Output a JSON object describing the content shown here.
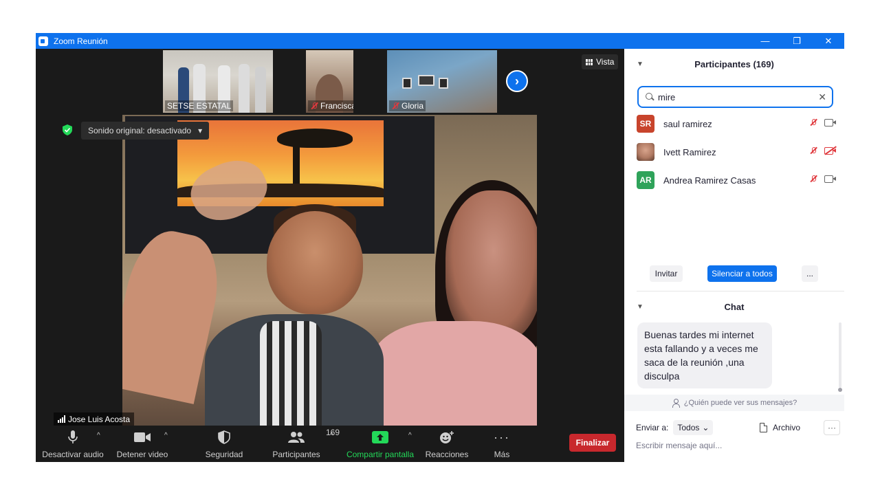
{
  "window": {
    "title": "Zoom Reunión",
    "controls": {
      "minimize": "—",
      "restore": "❐",
      "close": "✕"
    }
  },
  "thumbnails": [
    {
      "name": "SETSE ESTATAL",
      "muted": false
    },
    {
      "name": "Francisca",
      "muted": true
    },
    {
      "name": "Gloria",
      "muted": true
    }
  ],
  "view_button": {
    "label": "Vista"
  },
  "main_video": {
    "sound_label": "Sonido original: desactivado",
    "speaker_name": "Jose Luis Acosta"
  },
  "toolbar": {
    "audio": "Desactivar audio",
    "video": "Detener video",
    "security": "Seguridad",
    "participants": "Participantes",
    "participants_count": "169",
    "share": "Compartir pantalla",
    "reactions": "Reacciones",
    "more": "Más",
    "end": "Finalizar"
  },
  "participants_panel": {
    "title": "Participantes (169)",
    "search_value": "mire",
    "participants": [
      {
        "initials": "SR",
        "name": "saul ramirez",
        "avatar_color": "#c8442c",
        "video_off": false
      },
      {
        "initials": "",
        "name": "Ivett Ramirez",
        "avatar_color": "#b07a63",
        "video_off": true
      },
      {
        "initials": "AR",
        "name": "Andrea Ramirez Casas",
        "avatar_color": "#2fa35a",
        "video_off": false
      }
    ],
    "invite": "Invitar",
    "mute_all": "Silenciar a todos",
    "more": "..."
  },
  "chat_panel": {
    "title": "Chat",
    "message": "Buenas tardes mi internet esta fallando y a veces me saca de la reunión ,una disculpa",
    "who_can_see": "¿Quién puede ver sus mensajes?",
    "send_to_label": "Enviar a:",
    "send_to_value": "Todos",
    "file_label": "Archivo",
    "more": "···",
    "input_placeholder": "Escribir mensaje aquí..."
  },
  "colors": {
    "accent": "#0e72ed",
    "end_red": "#c8282d",
    "share_green": "#23d959",
    "muted_red": "#e0393e"
  }
}
